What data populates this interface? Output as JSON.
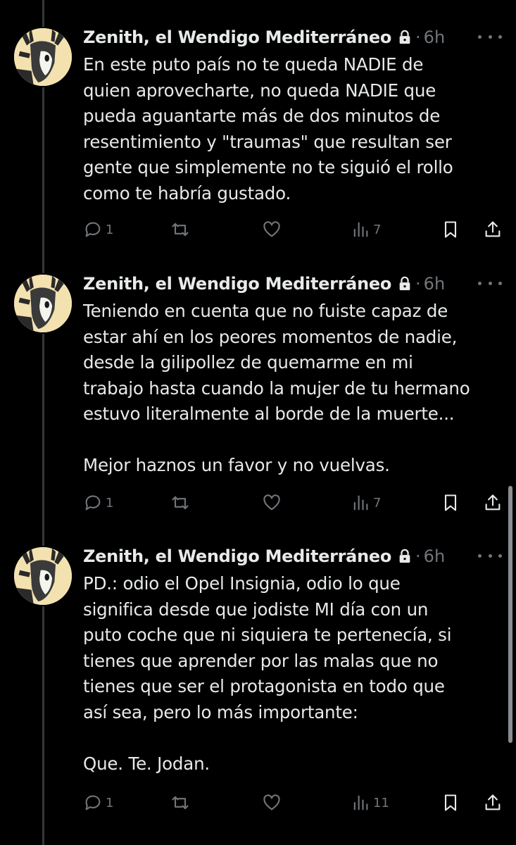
{
  "tweets": [
    {
      "author": "Zenith, el Wendigo Mediterráneo",
      "separator": "·",
      "time": "6h",
      "text": "En este puto país no te queda NADIE de\nquien aprovecharte, no queda NADIE que\npueda aguantarte más de dos minutos de\nresentimiento y \"traumas\" que resultan ser\ngente que simplemente no te siguió el rollo\ncomo te habría gustado.",
      "replies": "1",
      "views": "7"
    },
    {
      "author": "Zenith, el Wendigo Mediterráneo",
      "separator": "·",
      "time": "6h",
      "text": "Teniendo en cuenta que no fuiste capaz de\nestar ahí en los peores momentos de nadie,\ndesde la gilipollez de quemarme en mi\ntrabajo hasta cuando la mujer de tu hermano\nestuvo literalmente al borde de la muerte...\n\nMejor haznos un favor y no vuelvas.",
      "replies": "1",
      "views": "7"
    },
    {
      "author": "Zenith, el Wendigo Mediterráneo",
      "separator": "·",
      "time": "6h",
      "text": "PD.: odio el Opel Insignia, odio lo que\nsignifica desde que jodiste MI día con un\nputo coche que ni siquiera te pertenecía, si\ntienes que aprender por las malas que no\ntienes que ser el protagonista en todo que\nasí sea, pero lo más importante:\n\nQue. Te. Jodan.",
      "replies": "1",
      "views": "11"
    }
  ],
  "icons": {
    "avatar": "wendigo-deer-skull-avatar-icon",
    "lock": "lock-icon",
    "more": "more-options-icon",
    "reply": "reply-icon",
    "retweet": "retweet-icon",
    "like": "like-icon",
    "views": "views-icon",
    "bookmark": "bookmark-icon",
    "share": "share-icon"
  },
  "colors": {
    "background": "#000000",
    "text": "#e7e9ea",
    "muted": "#71767b",
    "thread_line": "#333639",
    "avatar_bg": "#f3e2b0"
  }
}
